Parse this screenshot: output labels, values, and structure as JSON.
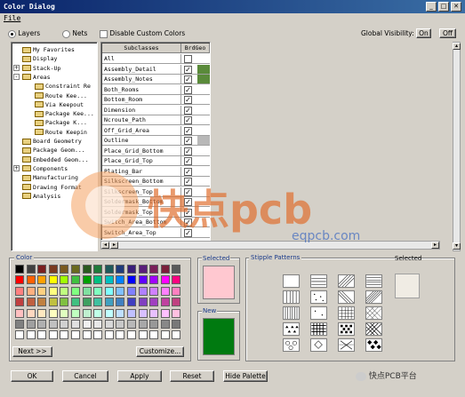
{
  "window": {
    "title": "Color Dialog",
    "minimize_glyph": "_",
    "maximize_glyph": "□",
    "close_glyph": "✕"
  },
  "menu": {
    "file": "File"
  },
  "options": {
    "layers_label": "Layers",
    "nets_label": "Nets",
    "disable_custom_colors": "Disable Custom Colors",
    "global_visibility": "Global Visibility:",
    "on_label": "On",
    "off_label": "Off"
  },
  "tree": {
    "items": [
      {
        "label": "My Favorites",
        "indent": 1
      },
      {
        "label": "Display",
        "indent": 1
      },
      {
        "label": "Stack-Up",
        "indent": 1,
        "expander": "+"
      },
      {
        "label": "Areas",
        "indent": 1,
        "expander": "-"
      },
      {
        "label": "Constraint Re",
        "indent": 2
      },
      {
        "label": "Route Kee...",
        "indent": 2
      },
      {
        "label": "Via Keepout",
        "indent": 2
      },
      {
        "label": "Package Kee...",
        "indent": 2
      },
      {
        "label": "Package K...",
        "indent": 2
      },
      {
        "label": "Route Keepin",
        "indent": 2
      },
      {
        "label": "Board Geometry",
        "indent": 1
      },
      {
        "label": "Package Geom...",
        "indent": 1
      },
      {
        "label": "Embedded Geom...",
        "indent": 1
      },
      {
        "label": "Components",
        "indent": 1,
        "expander": "+"
      },
      {
        "label": "Manufacturing",
        "indent": 1
      },
      {
        "label": "Drawing Format",
        "indent": 1
      },
      {
        "label": "Analysis",
        "indent": 1
      }
    ]
  },
  "grid": {
    "col_subclasses": "Subclasses",
    "col_brdgeo": "BrdGeo",
    "rows": [
      {
        "name": "All",
        "checked": false,
        "color": "#ffffff"
      },
      {
        "name": "Assembly_Detail",
        "checked": true,
        "color": "#5a8a3a"
      },
      {
        "name": "Assembly_Notes",
        "checked": true,
        "color": "#5a8a3a"
      },
      {
        "name": "Both_Rooms",
        "checked": true,
        "color": "#ffffff"
      },
      {
        "name": "Bottom_Room",
        "checked": true,
        "color": "#ffffff"
      },
      {
        "name": "Dimension",
        "checked": true,
        "color": "#ffffff"
      },
      {
        "name": "Ncroute_Path",
        "checked": true,
        "color": "#ffffff"
      },
      {
        "name": "Off_Grid_Area",
        "checked": true,
        "color": "#ffffff"
      },
      {
        "name": "Outline",
        "checked": true,
        "color": "#b8b8b8"
      },
      {
        "name": "Place_Grid_Bottom",
        "checked": true,
        "color": "#ffffff"
      },
      {
        "name": "Place_Grid_Top",
        "checked": true,
        "color": "#ffffff"
      },
      {
        "name": "Plating_Bar",
        "checked": true,
        "color": "#ffffff"
      },
      {
        "name": "Silkscreen_Bottom",
        "checked": true,
        "color": "#ffffff"
      },
      {
        "name": "Silkscreen_Top",
        "checked": true,
        "color": "#ffffff"
      },
      {
        "name": "Soldermask_Bottom",
        "checked": true,
        "color": "#ffffff"
      },
      {
        "name": "Soldermask_Top",
        "checked": true,
        "color": "#ffffff"
      },
      {
        "name": "Switch_Area_Bottom",
        "checked": true,
        "color": "#ffffff"
      },
      {
        "name": "Switch_Area_Top",
        "checked": true,
        "color": "#ffffff"
      }
    ]
  },
  "color_section": {
    "label": "Color",
    "palette": [
      "#000000",
      "#404040",
      "#7a1f1f",
      "#7a3a1f",
      "#7a5a1f",
      "#6a6a1f",
      "#2a5a1f",
      "#1f7a3a",
      "#1f5a5a",
      "#1f3a7a",
      "#3a1f7a",
      "#5a1f7a",
      "#7a1f5a",
      "#7a1f3a",
      "#5a5a5a",
      "#ff0000",
      "#ff6000",
      "#ffa000",
      "#ffff00",
      "#a0ff00",
      "#40c040",
      "#00a000",
      "#00c080",
      "#00c0c0",
      "#0080ff",
      "#0000ff",
      "#6000ff",
      "#a000ff",
      "#ff00ff",
      "#ff0080",
      "#ff8080",
      "#ffb080",
      "#ffd080",
      "#ffff80",
      "#c0ff80",
      "#80ff80",
      "#80e0a0",
      "#80ffc0",
      "#80ffff",
      "#80c0ff",
      "#8080ff",
      "#b080ff",
      "#d080ff",
      "#ff80ff",
      "#ff80c0",
      "#c04040",
      "#c06040",
      "#c08040",
      "#c0c040",
      "#80c040",
      "#40c080",
      "#40a060",
      "#40c0a0",
      "#40a0c0",
      "#4080c0",
      "#4040c0",
      "#8040c0",
      "#a040c0",
      "#c040a0",
      "#c04080",
      "#ffc0c0",
      "#ffd8c0",
      "#ffe8c0",
      "#ffffc0",
      "#e0ffc0",
      "#c0ffc0",
      "#c0f0d0",
      "#c0ffe8",
      "#c0ffff",
      "#c0e0ff",
      "#c0c0ff",
      "#d8c0ff",
      "#e8c0ff",
      "#ffc0ff",
      "#ffc0e0",
      "#808080",
      "#a0a0a0",
      "#b0b0b0",
      "#c0c0c0",
      "#d0d0d0",
      "#e0e0e0",
      "#f0f0f0",
      "#e8e8e8",
      "#d8d8d8",
      "#c8c8c8",
      "#b8b8b8",
      "#a8a8a8",
      "#989898",
      "#888888",
      "#787878",
      "#ffffff",
      "#ffffff",
      "#ffffff",
      "#ffffff",
      "#ffffff",
      "#ffffff",
      "#ffffff",
      "#ffffff",
      "#ffffff",
      "#ffffff",
      "#ffffff",
      "#ffffff",
      "#ffffff",
      "#ffffff",
      "#ffffff"
    ],
    "next_label": "Next >>",
    "customize_label": "Customize..."
  },
  "selected_color": {
    "label": "Selected",
    "color": "#ffc8d0"
  },
  "new_color": {
    "label": "New",
    "color": "#007a10"
  },
  "stipple": {
    "label": "Stipple Patterns",
    "selected_label": "Selected",
    "patterns": [
      "blank",
      "hlines",
      "diag-right",
      "hlines-dense",
      "vlines",
      "dots",
      "diag-left",
      "diag-right-dense",
      "vlines-dense",
      "dots-sparse",
      "grid",
      "crosshatch",
      "triangles",
      "crosshatch-bold",
      "checker",
      "dense-diag",
      "circles",
      "diamonds",
      "x-pattern",
      "diamond-checker"
    ]
  },
  "buttons": {
    "ok": "OK",
    "cancel": "Cancel",
    "apply": "Apply",
    "reset": "Reset",
    "hide_palette": "Hide Palette"
  },
  "watermark": {
    "brand": "快点pcb",
    "url": "eqpcb.com",
    "social": "快点PCB平台"
  }
}
